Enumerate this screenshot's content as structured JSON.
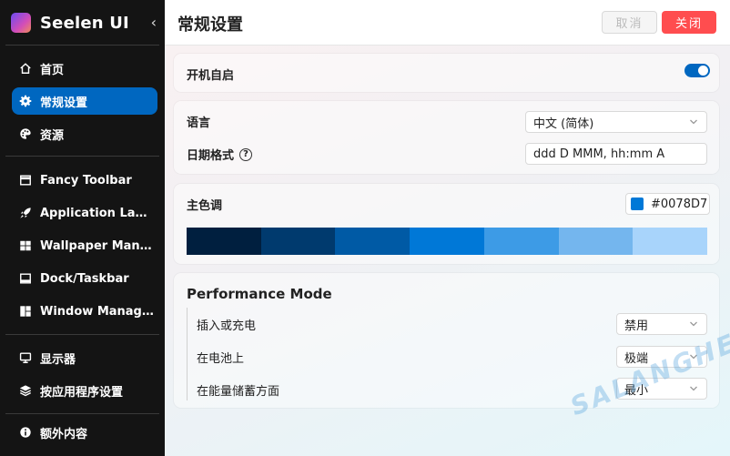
{
  "app": {
    "title": "Seelen UI",
    "collapse_glyph": "‹"
  },
  "sidebar": {
    "items": [
      {
        "label": "首页",
        "icon": "home-icon"
      },
      {
        "label": "常规设置",
        "icon": "gear-icon",
        "active": true
      },
      {
        "label": "资源",
        "icon": "palette-icon"
      },
      {
        "label": "Fancy Toolbar",
        "icon": "toolbar-icon"
      },
      {
        "label": "Application Launcher",
        "icon": "rocket-icon"
      },
      {
        "label": "Wallpaper Manager",
        "icon": "wallpaper-icon"
      },
      {
        "label": "Dock/Taskbar",
        "icon": "dock-icon"
      },
      {
        "label": "Window Manager",
        "icon": "window-manager-icon"
      },
      {
        "label": "显示器",
        "icon": "monitor-icon"
      },
      {
        "label": "按应用程序设置",
        "icon": "layers-icon"
      },
      {
        "label": "额外内容",
        "icon": "info-icon"
      }
    ]
  },
  "header": {
    "title": "常规设置",
    "cancel_label": "取消",
    "close_label": "关闭"
  },
  "startup": {
    "label": "开机自启",
    "enabled": true
  },
  "language": {
    "label": "语言",
    "value": "中文 (简体)"
  },
  "date_format": {
    "label": "日期格式",
    "help": "?",
    "value": "ddd D MMM, hh:mm A"
  },
  "accent": {
    "label": "主色调",
    "value": "#0078D7",
    "swatch": "#0078d7",
    "palette": [
      "#001f3f",
      "#003a6e",
      "#005aa5",
      "#0078d7",
      "#3d9be6",
      "#74b6ee",
      "#a8d4fb"
    ]
  },
  "performance": {
    "title": "Performance Mode",
    "rows": [
      {
        "label": "插入或充电",
        "value": "禁用"
      },
      {
        "label": "在电池上",
        "value": "极端"
      },
      {
        "label": "在能量储蓄方面",
        "value": "最小"
      }
    ]
  },
  "watermark": "SALANGHE",
  "colors": {
    "accent": "#0067c0",
    "danger": "#ff4d4f",
    "sidebar_bg": "#141414"
  }
}
